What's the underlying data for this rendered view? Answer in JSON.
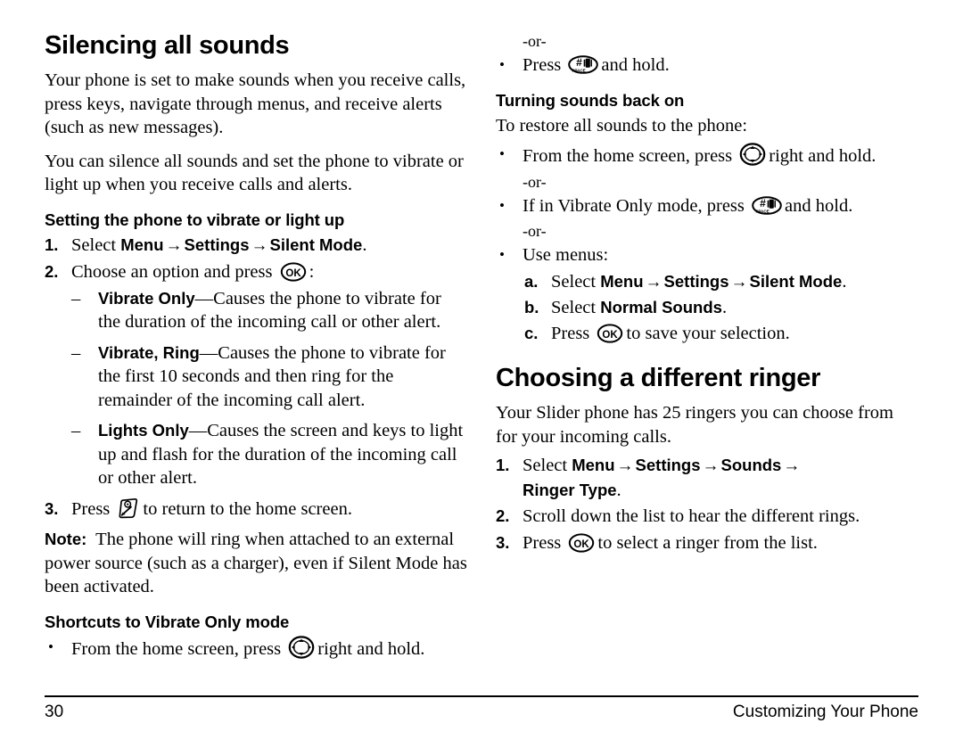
{
  "page": {
    "number": "30",
    "running_header": "Customizing Your Phone"
  },
  "left_column": {
    "heading": "Silencing all sounds",
    "intro_paragraph_1": "Your phone is set to make sounds when you receive calls, press keys, navigate through menus, and receive alerts (such as new messages).",
    "intro_paragraph_2": "You can silence all sounds and set the phone to vibrate or light up when you receive calls and alerts.",
    "subheading_1": "Setting the phone to vibrate or light up",
    "step1": {
      "number": "1.",
      "verb": "Select",
      "menu": "Menu",
      "arrow": "→",
      "settings": "Settings",
      "silent_mode": "Silent Mode",
      "period": "."
    },
    "step2": {
      "number": "2.",
      "text_before": "Choose an option and press",
      "text_after": ":"
    },
    "options": [
      {
        "marker": "–",
        "term": "Vibrate Only",
        "dash": "—",
        "definition": "Causes the phone to vibrate for the duration of the incoming call or other alert."
      },
      {
        "marker": "–",
        "term": "Vibrate, Ring",
        "dash": "—",
        "definition": "Causes the phone to vibrate for the first 10 seconds and then ring for the remainder of the incoming call alert."
      },
      {
        "marker": "–",
        "term": "Lights Only",
        "dash": "—",
        "definition": "Causes the screen and keys to light up and flash for the duration of the incoming call or other alert."
      }
    ],
    "step3": {
      "number": "3.",
      "text_before": "Press",
      "text_after": "to return to the home screen."
    },
    "note": {
      "label": "Note:",
      "text": "The phone will ring when attached to an external power source (such as a charger), even if Silent Mode has been activated."
    },
    "subheading_2": "Shortcuts to Vibrate Only mode",
    "shortcut_bullet": {
      "marker": "•",
      "text_before": "From the home screen, press",
      "text_after": "right and hold."
    }
  },
  "right_column": {
    "or_1": "-or-",
    "bullet_press_pound": {
      "marker": "•",
      "text_before": "Press",
      "text_after": "and hold."
    },
    "subheading_1": "Turning sounds back on",
    "intro": "To restore all sounds to the phone:",
    "bullet_home_screen": {
      "marker": "•",
      "text_before": "From the home screen, press",
      "text_after": "right and hold."
    },
    "or_2": "-or-",
    "bullet_vibrate_only": {
      "marker": "•",
      "text_before": "If in Vibrate Only mode, press",
      "text_after": "and hold."
    },
    "or_3": "-or-",
    "bullet_use_menus": {
      "marker": "•",
      "text": "Use menus:"
    },
    "substep_a": {
      "marker": "a.",
      "verb": "Select",
      "menu": "Menu",
      "arrow": "→",
      "settings": "Settings",
      "silent_mode": "Silent Mode",
      "period": "."
    },
    "substep_b": {
      "marker": "b.",
      "verb": "Select",
      "term": "Normal Sounds",
      "period": "."
    },
    "substep_c": {
      "marker": "c.",
      "text_before": "Press",
      "text_after": "to save your selection."
    },
    "heading_2": "Choosing a different ringer",
    "ringer_intro": "Your Slider phone has 25 ringers you can choose from for your incoming calls.",
    "ringer_step1": {
      "number": "1.",
      "verb": "Select",
      "menu": "Menu",
      "arrow": "→",
      "settings": "Settings",
      "sounds": "Sounds",
      "ringer_type": "Ringer Type",
      "period": "."
    },
    "ringer_step2": {
      "number": "2.",
      "text": "Scroll down the list to hear the different rings."
    },
    "ringer_step3": {
      "number": "3.",
      "text_before": "Press",
      "text_after": "to select a ringer from the list."
    }
  },
  "icons": {
    "ok_key": "ok-key-icon",
    "nav_ring_key": "navigation-ring-key-icon",
    "pound_space_key": "pound-space-key-icon",
    "end_key": "end-power-key-icon",
    "pound_key_label": "#",
    "space_key_label": "SPACE",
    "ok_key_label": "OK"
  }
}
